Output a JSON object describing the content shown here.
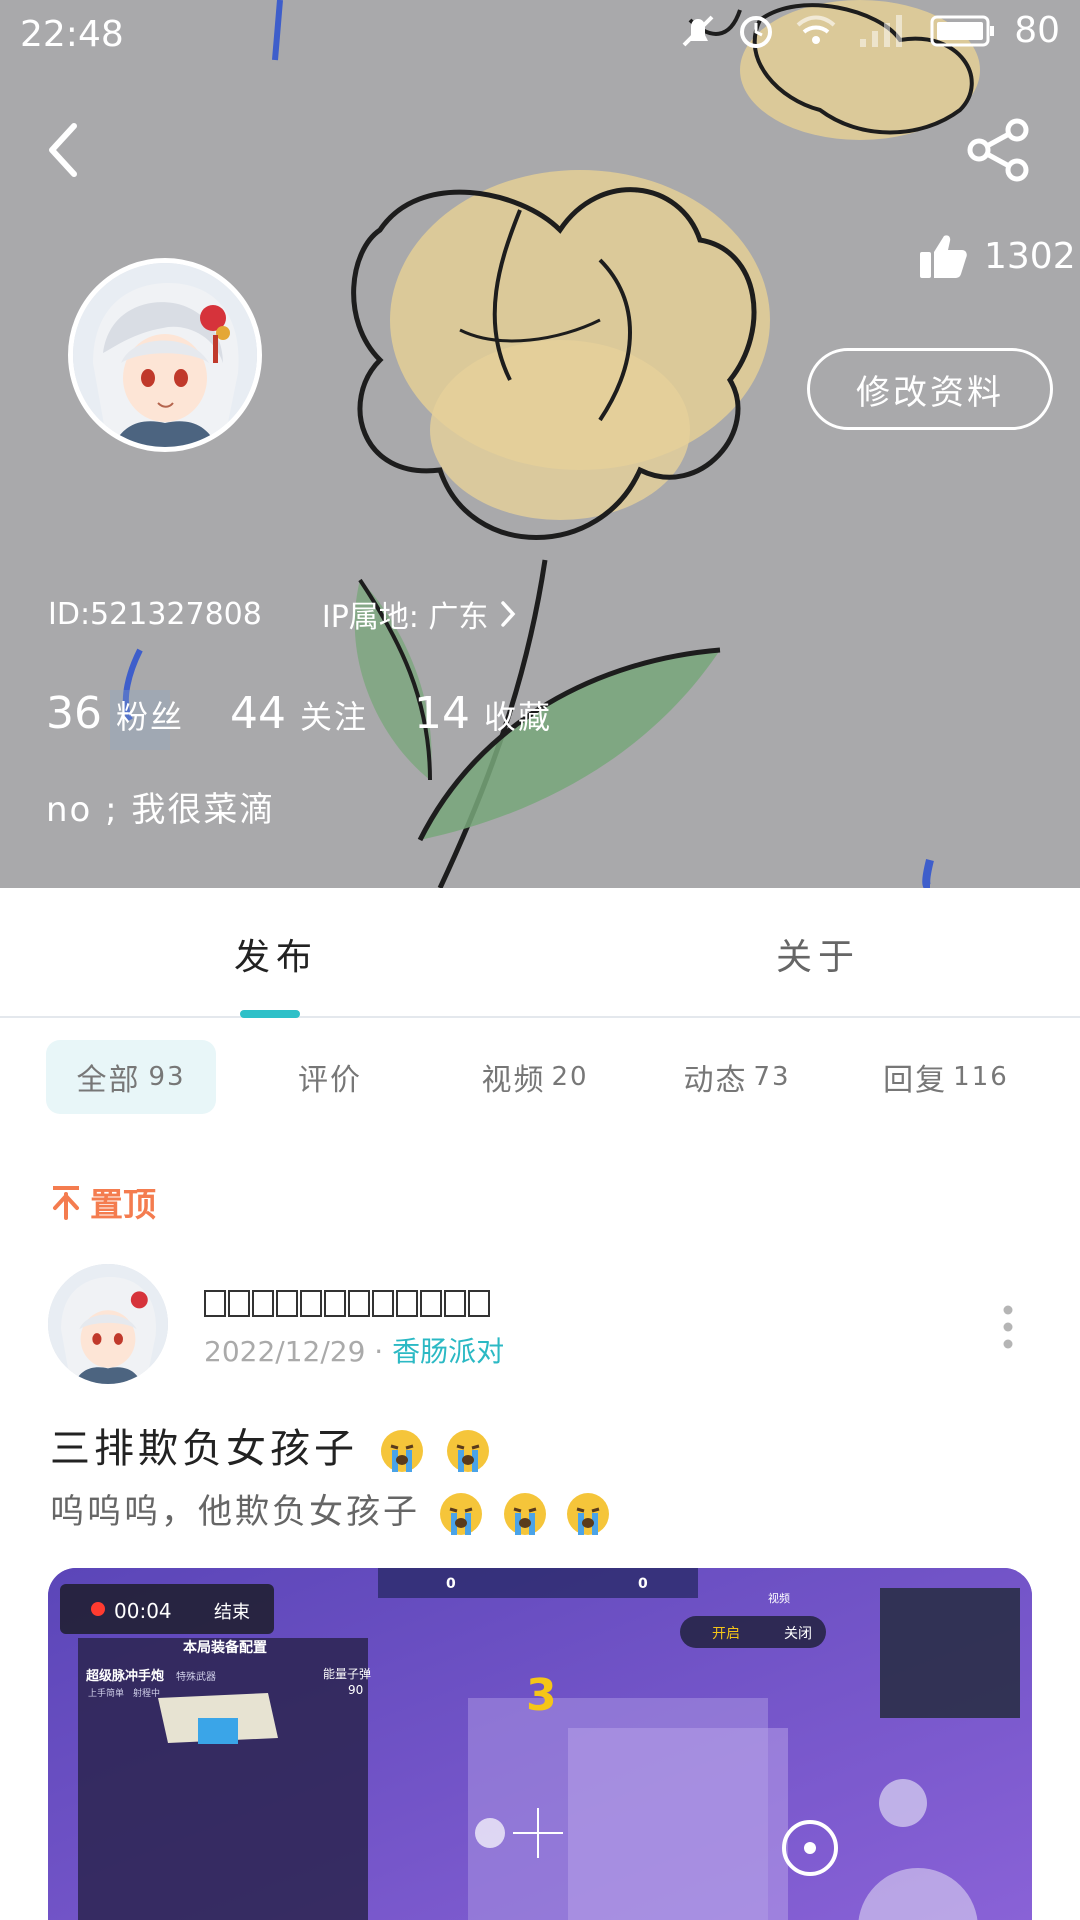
{
  "status_bar": {
    "time": "22:48",
    "battery": "80"
  },
  "profile": {
    "likes": "1302",
    "edit_button": "修改资料",
    "id_text": "ID:521327808",
    "ip_text": "IP属地: 广东",
    "stats": [
      {
        "num": "36",
        "label": "粉丝"
      },
      {
        "num": "44",
        "label": "关注"
      },
      {
        "num": "14",
        "label": "收藏"
      }
    ],
    "bio": "no ; 我很菜滴"
  },
  "tabs": {
    "publish": "发布",
    "about": "关于"
  },
  "chips": [
    {
      "label": "全部",
      "count": "93"
    },
    {
      "label": "评价",
      "count": ""
    },
    {
      "label": "视频",
      "count": "20"
    },
    {
      "label": "动态",
      "count": "73"
    },
    {
      "label": "回复",
      "count": "116"
    }
  ],
  "pinned_label": "置顶",
  "post": {
    "date": "2022/12/29",
    "separator": "·",
    "game": "香肠派对",
    "title": "三排欺负女孩子",
    "body": "呜呜呜，他欺负女孩子"
  },
  "media_overlay": {
    "timer": "00:04",
    "end": "结束",
    "config_title": "本局装备配置",
    "weapon": "超级脉冲手炮",
    "weapon_tag": "特殊武器",
    "tag1": "上手简单",
    "tag2": "射程中",
    "ammo_label": "能量子弹",
    "ammo_count": "90",
    "count_down": "3",
    "score_left": "0",
    "score_right": "0",
    "on_label": "开启",
    "off_label": "关闭",
    "view_label": "视频"
  },
  "colors": {
    "accent": "#2ec0c8",
    "pinned": "#f47c4f",
    "banner_bg": "#a9a9ab"
  }
}
